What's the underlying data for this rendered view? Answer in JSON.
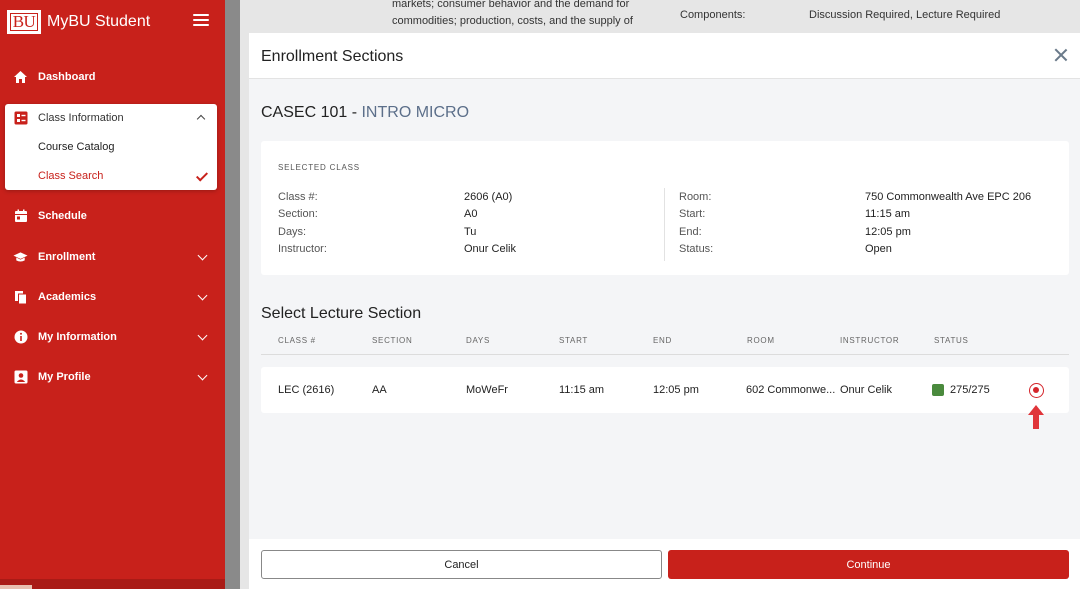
{
  "app": {
    "logo_text": "BU",
    "name": "MyBU Student"
  },
  "sidebar": {
    "items": [
      {
        "label": "Dashboard",
        "icon": "home-icon"
      },
      {
        "label": "Class Information",
        "icon": "class-info-icon",
        "expanded": true,
        "children": [
          {
            "label": "Course Catalog"
          },
          {
            "label": "Class Search",
            "active": true
          }
        ]
      },
      {
        "label": "Schedule",
        "icon": "calendar-icon"
      },
      {
        "label": "Enrollment",
        "icon": "graduation-cap-icon"
      },
      {
        "label": "Academics",
        "icon": "documents-icon"
      },
      {
        "label": "My Information",
        "icon": "info-icon"
      },
      {
        "label": "My Profile",
        "icon": "profile-icon"
      }
    ],
    "active_color": "#c8211b"
  },
  "background_page": {
    "description_lines": [
      "markets; consumer behavior and the demand for",
      "commodities; production, costs, and the supply of"
    ],
    "components_label": "Components:",
    "components_value": "Discussion Required, Lecture Required"
  },
  "modal": {
    "title": "Enrollment Sections",
    "course_code": "CASEC 101 - ",
    "course_name": "INTRO MICRO",
    "selected_class": {
      "heading": "SELECTED CLASS",
      "left": [
        {
          "label": "Class #:",
          "value": "2606 (A0)"
        },
        {
          "label": "Section:",
          "value": "A0"
        },
        {
          "label": "Days:",
          "value": "Tu"
        },
        {
          "label": "Instructor:",
          "value": "Onur Celik"
        }
      ],
      "right": [
        {
          "label": "Room:",
          "value": "750 Commonwealth Ave EPC 206"
        },
        {
          "label": "Start:",
          "value": "11:15 am"
        },
        {
          "label": "End:",
          "value": "12:05 pm"
        },
        {
          "label": "Status:",
          "value": "Open"
        }
      ]
    },
    "lecture_heading": "Select Lecture Section",
    "columns": [
      "CLASS #",
      "SECTION",
      "DAYS",
      "START",
      "END",
      "ROOM",
      "INSTRUCTOR",
      "STATUS"
    ],
    "rows": [
      {
        "class_num": "LEC (2616)",
        "section": "AA",
        "days": "MoWeFr",
        "start": "11:15 am",
        "end": "12:05 pm",
        "room": "602 Commonwe...",
        "instructor": "Onur Celik",
        "status": "275/275",
        "status_color": "#4a8a3d",
        "selected": true
      }
    ],
    "footer": {
      "cancel_label": "Cancel",
      "continue_label": "Continue"
    }
  },
  "colors": {
    "brand_red": "#c8211b",
    "arrow_red": "#e0353a"
  }
}
